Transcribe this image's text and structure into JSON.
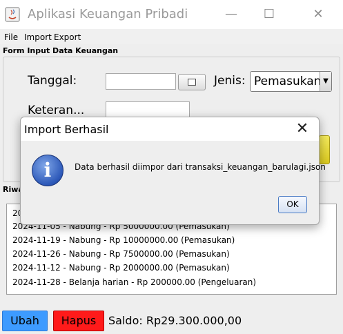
{
  "window": {
    "title": "Aplikasi Keuangan Pribadi",
    "minimize": "—",
    "maximize": "☐",
    "close": "✕"
  },
  "menu": {
    "file": "File",
    "import": "Import",
    "export": "Export"
  },
  "form": {
    "section_title": "Form Input Data Keuangan",
    "tanggal_label": "Tanggal:",
    "tanggal_value": "",
    "jenis_label": "Jenis:",
    "jenis_value": "Pemasukan",
    "keterangan_label": "Keteran...",
    "keterangan_value": ""
  },
  "history": {
    "section_title": "Riwa",
    "items": [
      "20",
      "2024-11-05 - Nabung - Rp 5000000.00 (Pemasukan)",
      "2024-11-19 - Nabung - Rp 10000000.00 (Pemasukan)",
      "2024-11-26 - Nabung - Rp 7500000.00 (Pemasukan)",
      "2024-11-12 - Nabung - Rp 2000000.00 (Pemasukan)",
      "2024-11-28 - Belanja harian - Rp 200000.00 (Pengeluaran)"
    ]
  },
  "actions": {
    "ubah": "Ubah",
    "hapus": "Hapus",
    "saldo": "Saldo: Rp29.300.000,00"
  },
  "dialog": {
    "title": "Import Berhasil",
    "close": "✕",
    "icon": "i",
    "message": "Data berhasil diimpor dari transaksi_keuangan_barulagi.json",
    "ok": "OK"
  },
  "colors": {
    "ubah": "#3d9bff",
    "hapus": "#ff1a1a",
    "info_icon": "#2c58b8"
  }
}
